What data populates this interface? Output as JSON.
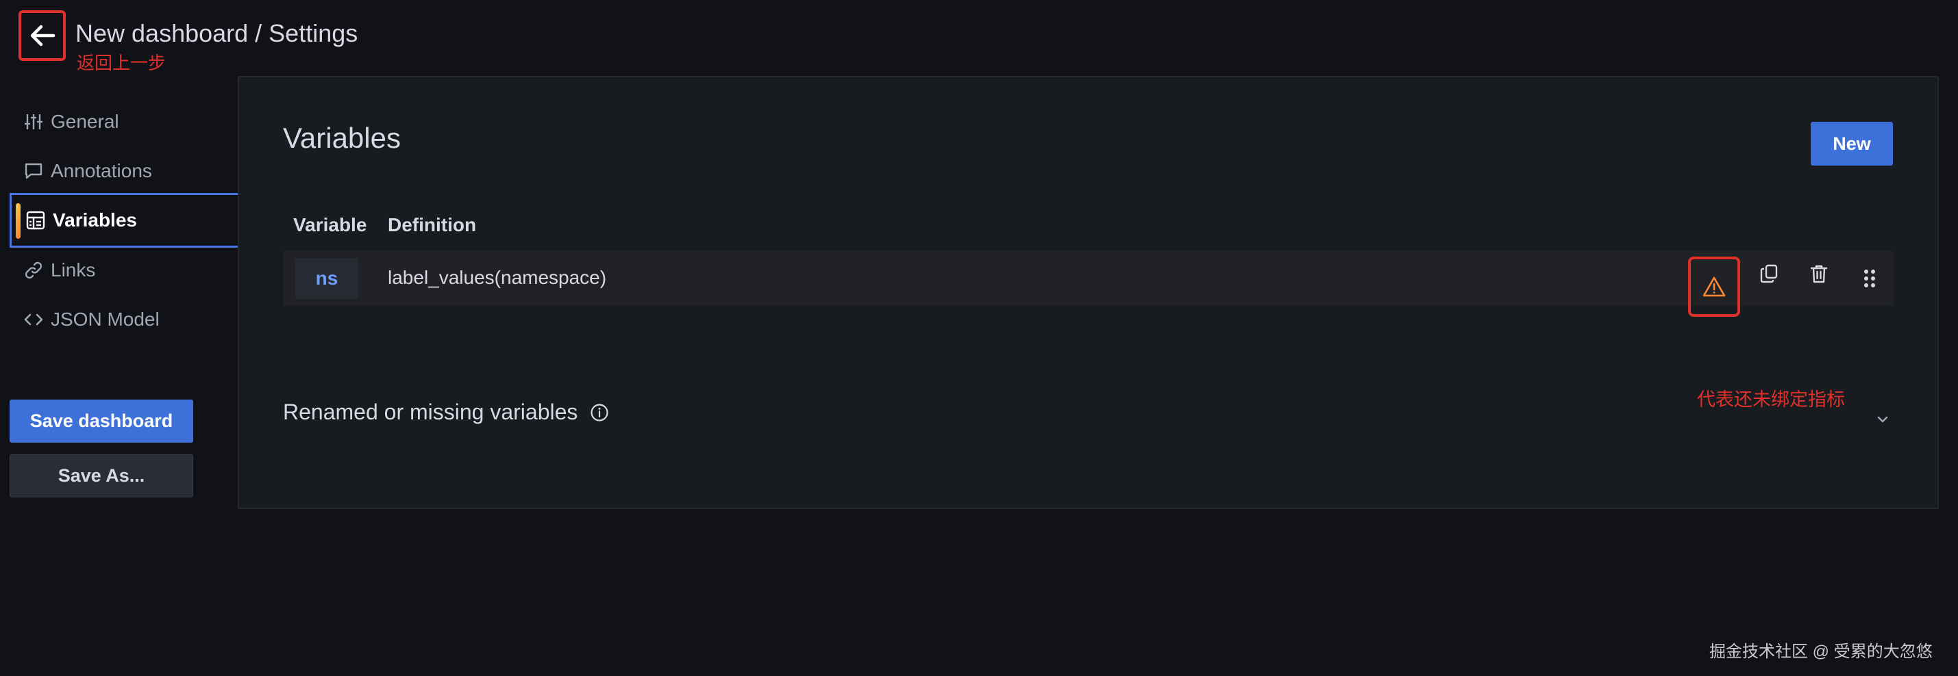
{
  "header": {
    "title": "New dashboard / Settings",
    "back_annotation": "返回上一步"
  },
  "sidebar": {
    "items": [
      {
        "label": "General",
        "icon": "sliders-icon"
      },
      {
        "label": "Annotations",
        "icon": "comment-icon"
      },
      {
        "label": "Variables",
        "icon": "variables-table-icon",
        "active": true
      },
      {
        "label": "Links",
        "icon": "link-icon"
      },
      {
        "label": "JSON Model",
        "icon": "code-icon"
      }
    ],
    "save_dashboard_label": "Save dashboard",
    "save_as_label": "Save As..."
  },
  "variables": {
    "title": "Variables",
    "new_button_label": "New",
    "columns": {
      "variable": "Variable",
      "definition": "Definition"
    },
    "rows": [
      {
        "name": "ns",
        "definition": "label_values(namespace)"
      }
    ],
    "warning_annotation": "代表还未绑定指标"
  },
  "renamed": {
    "title": "Renamed or missing variables"
  },
  "watermark": "掘金技术社区 @ 受累的大忽悠",
  "colors": {
    "background": "#111217",
    "panel": "#181b1f",
    "primary": "#3d71d9",
    "annotation_red": "#e0302a",
    "warning_orange": "#ff8833"
  }
}
